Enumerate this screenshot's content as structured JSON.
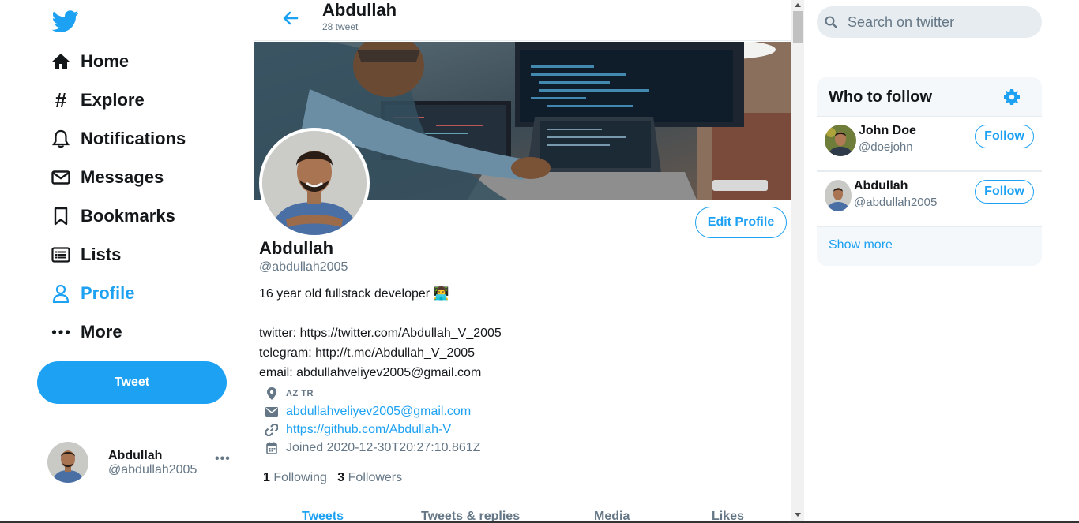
{
  "nav": {
    "items": [
      {
        "label": "Home",
        "icon": "home-icon"
      },
      {
        "label": "Explore",
        "icon": "hashtag-icon"
      },
      {
        "label": "Notifications",
        "icon": "bell-icon"
      },
      {
        "label": "Messages",
        "icon": "envelope-icon"
      },
      {
        "label": "Bookmarks",
        "icon": "bookmark-icon"
      },
      {
        "label": "Lists",
        "icon": "list-icon"
      },
      {
        "label": "Profile",
        "icon": "user-icon",
        "active": true
      },
      {
        "label": "More",
        "icon": "ellipsis-icon"
      }
    ],
    "tweet_label": "Tweet",
    "accent_color": "#1da1f2"
  },
  "account": {
    "name": "Abdullah",
    "handle": "@abdullah2005",
    "more": "•••"
  },
  "header": {
    "title": "Abdullah",
    "subtitle": "28 tweet"
  },
  "profile": {
    "edit_label": "Edit Profile",
    "name": "Abdullah",
    "handle": "@abdullah2005",
    "bio": "16 year old fullstack developer 👨‍💻\n\ntwitter: https://twitter.com/Abdullah_V_2005\ntelegram: http://t.me/Abdullah_V_2005\nemail: abdullahveliyev2005@gmail.com",
    "location": "AZ TR",
    "email": "abdullahveliyev2005@gmail.com",
    "website": "https://github.com/Abdullah-V",
    "joined": "Joined 2020-12-30T20:27:10.861Z",
    "following_count": "1",
    "following_label": "Following",
    "followers_count": "3",
    "followers_label": "Followers"
  },
  "tabs": [
    {
      "label": "Tweets",
      "active": true
    },
    {
      "label": "Tweets & replies"
    },
    {
      "label": "Media"
    },
    {
      "label": "Likes"
    }
  ],
  "search": {
    "placeholder": "Search on twitter"
  },
  "who_to_follow": {
    "title": "Who to follow",
    "users": [
      {
        "name": "John Doe",
        "handle": "@doejohn",
        "button": "Follow"
      },
      {
        "name": "Abdullah",
        "handle": "@abdullah2005",
        "button": "Follow"
      }
    ],
    "show_more": "Show more"
  }
}
